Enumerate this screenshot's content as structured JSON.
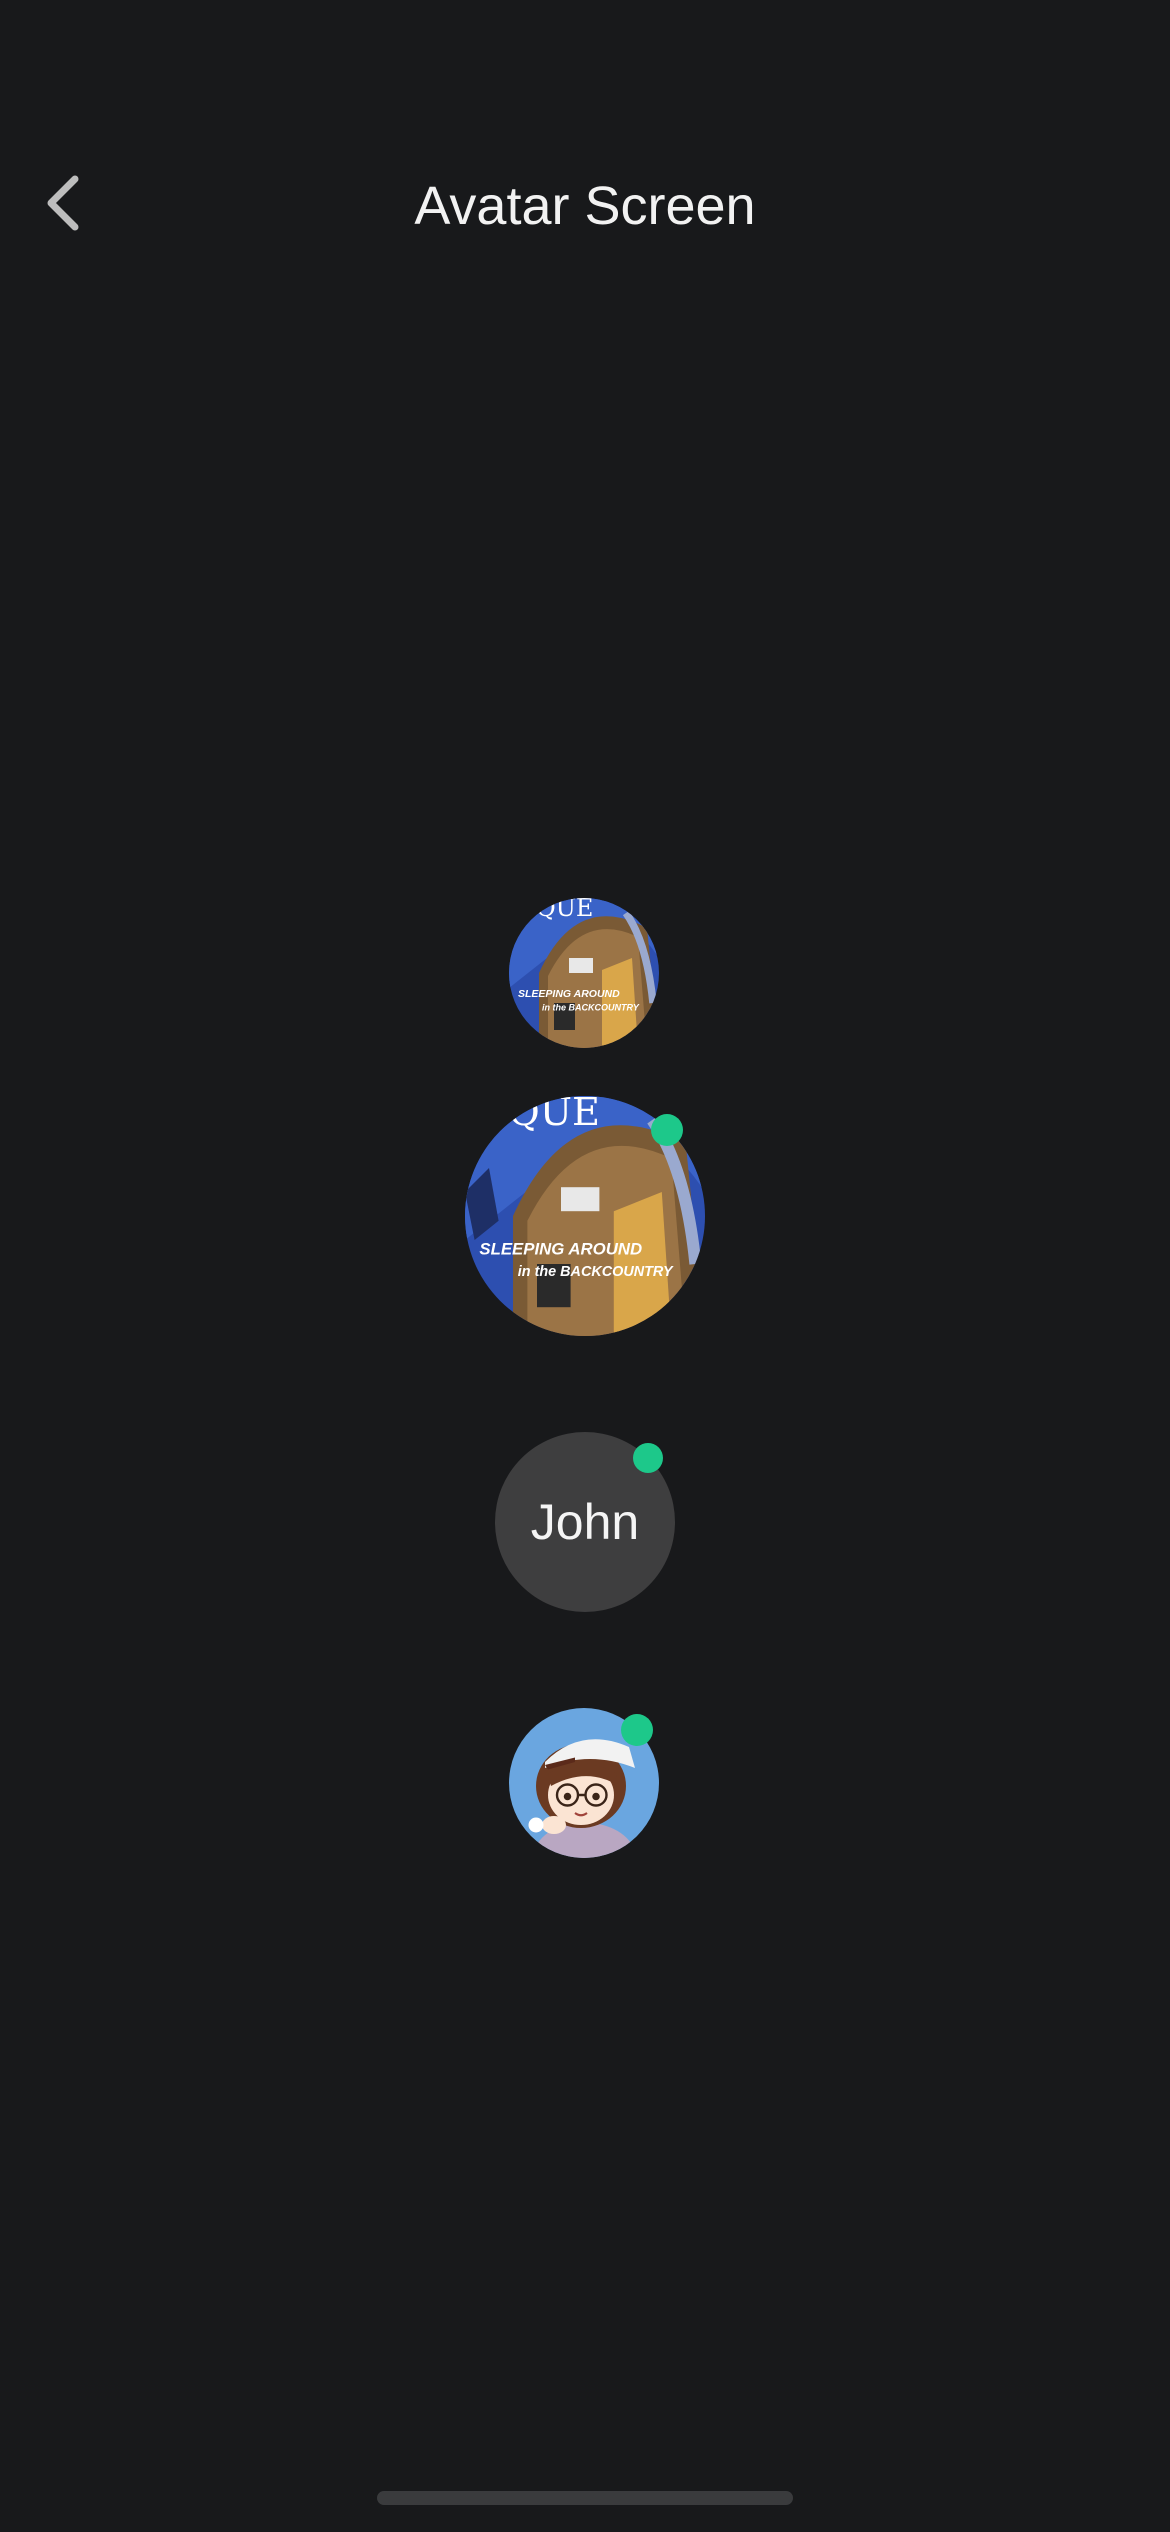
{
  "header": {
    "title": "Avatar Screen",
    "back_icon": "chevron-left-icon"
  },
  "avatars": [
    {
      "kind": "image",
      "image": "cabin-magazine-cover",
      "online": false,
      "cover_masthead": "QUE",
      "cover_headline_1": "SLEEPING AROUND",
      "cover_headline_2": "in the BACKCOUNTRY"
    },
    {
      "kind": "image",
      "image": "cabin-magazine-cover",
      "online": true,
      "cover_masthead": "QUE",
      "cover_headline_1": "SLEEPING AROUND",
      "cover_headline_2": "in the BACKCOUNTRY"
    },
    {
      "kind": "initials",
      "label": "John",
      "online": true
    },
    {
      "kind": "image",
      "image": "cartoon-character-with-cap",
      "online": true
    }
  ],
  "colors": {
    "background": "#18191b",
    "online_dot": "#1dc88a",
    "initials_bg": "#3e3e3f"
  }
}
